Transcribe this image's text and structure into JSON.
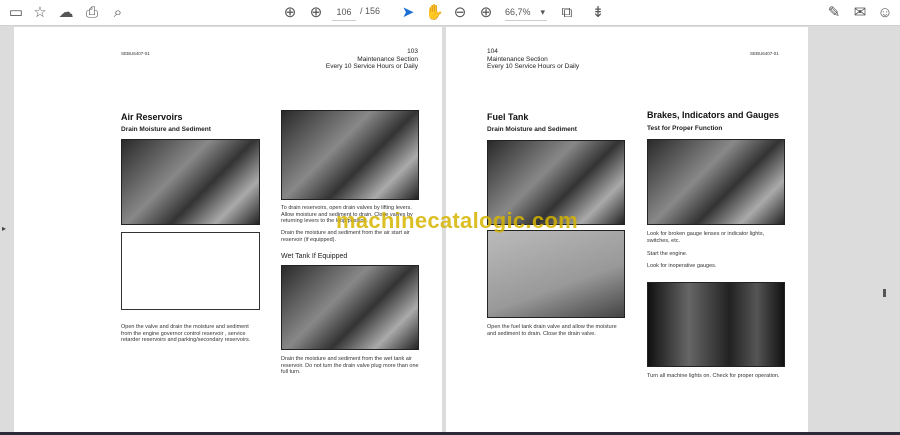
{
  "toolbar": {
    "left_icons": [
      "save-icon",
      "bookmark-star-icon",
      "upload-cloud-icon",
      "print-icon",
      "search-zoom-icon"
    ],
    "page_current": "106",
    "page_total": "/ 156",
    "zoom_value": "66,7%",
    "right_icons": [
      "sign-icon",
      "mail-icon",
      "add-user-icon"
    ]
  },
  "left_page": {
    "doc_id": "SEBU6407-01",
    "page_number": "103",
    "section": "Maintenance Section",
    "interval": "Every 10 Service Hours or Daily",
    "heading": "Air Reservoirs",
    "subheading": "Drain Moisture and Sediment",
    "caption1": "Open the valve and drain the moisture and sediment from the engine governor control reservoir , service retarder reservoirs and parking/secondary reservoirs.",
    "caption2": "To drain reservoirs, open drain valves by lifting levers. Allow moisture and sediment to drain. Close valves by returning levers to the loop position.",
    "caption3": "Drain the moisture and sediment from the air start air reservoir (if equipped).",
    "wet_tank_heading": "Wet Tank If Equipped",
    "caption4": "Drain the moisture and sediment from the wet tank air reservoir. Do not turn the drain valve plug more than one full turn."
  },
  "right_page": {
    "page_number": "104",
    "section": "Maintenance Section",
    "interval": "Every 10 Service Hours or Daily",
    "doc_id": "SEBU6407-01",
    "heading": "Fuel Tank",
    "subheading": "Drain Moisture and Sediment",
    "caption1": "Open the fuel tank drain valve and allow the moisture and sediment to drain. Close the drain valve.",
    "heading2": "Brakes, Indicators and Gauges",
    "subheading2": "Test for Proper Function",
    "caption2": "Look for broken gauge lenses or indicator lights, switches, etc.",
    "caption3": "Start the engine.",
    "caption4": "Look for inoperative gauges.",
    "caption5": "Turn all machine lights on. Check for proper operation."
  },
  "watermark": "machinecatalogic.com"
}
